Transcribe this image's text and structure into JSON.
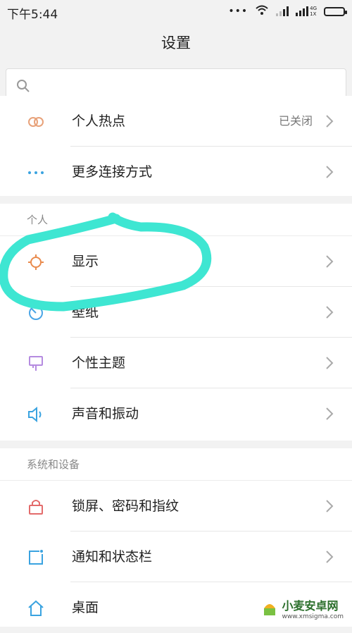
{
  "statusbar": {
    "time": "下午5:44",
    "net_top": "4G",
    "net_bottom": "1X"
  },
  "header": {
    "title": "设置"
  },
  "search": {
    "placeholder": ""
  },
  "groups": {
    "network": [
      {
        "icon": "hotspot-icon",
        "label": "个人热点",
        "value": "已关闭"
      },
      {
        "icon": "more-connections-icon",
        "label": "更多连接方式"
      }
    ],
    "personal": {
      "title": "个人",
      "items": [
        {
          "icon": "display-brightness-icon",
          "label": "显示"
        },
        {
          "icon": "wallpaper-icon",
          "label": "壁纸"
        },
        {
          "icon": "theme-brush-icon",
          "label": "个性主题"
        },
        {
          "icon": "sound-speaker-icon",
          "label": "声音和振动"
        }
      ]
    },
    "system": {
      "title": "系统和设备",
      "items": [
        {
          "icon": "lock-icon",
          "label": "锁屏、密码和指纹"
        },
        {
          "icon": "notification-icon",
          "label": "通知和状态栏"
        },
        {
          "icon": "home-icon",
          "label": "桌面"
        }
      ]
    }
  },
  "watermark": {
    "title": "小麦安卓网",
    "url": "www.xmsigma.com"
  },
  "colors": {
    "highlight": "#3ee6d2",
    "hotspot": "#e8a27a",
    "more": "#3aa3e0",
    "display": "#e98a4c",
    "wallpaper": "#4aa5e6",
    "theme": "#b58be0",
    "sound": "#3aa3e0",
    "lock": "#e36b6b",
    "notification": "#3aa3e0",
    "home": "#3aa3e0"
  }
}
